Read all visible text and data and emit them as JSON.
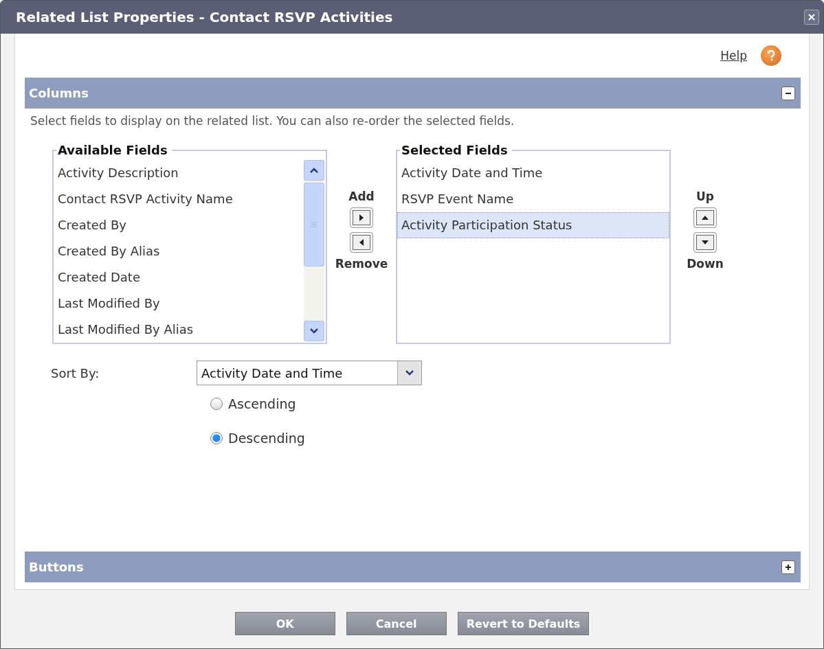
{
  "window": {
    "title": "Related List Properties - Contact RSVP Activities"
  },
  "help": {
    "label": "Help"
  },
  "sections": [
    {
      "title": "Columns",
      "expanded": true
    },
    {
      "title": "Buttons",
      "expanded": false
    }
  ],
  "description": "Select fields to display on the related list. You can also re-order the selected fields.",
  "available_fields": {
    "legend": "Available Fields",
    "items": [
      {
        "label": "Activity Description"
      },
      {
        "label": "Contact RSVP Activity Name"
      },
      {
        "label": "Created By"
      },
      {
        "label": "Created By Alias"
      },
      {
        "label": "Created Date"
      },
      {
        "label": "Last Modified By"
      },
      {
        "label": "Last Modified By Alias"
      }
    ]
  },
  "add_remove": {
    "add": "Add",
    "remove": "Remove"
  },
  "selected_fields": {
    "legend": "Selected Fields",
    "items": [
      {
        "label": "Activity Date and Time",
        "selected": false
      },
      {
        "label": "RSVP Event Name",
        "selected": false
      },
      {
        "label": "Activity Participation Status",
        "selected": true
      }
    ]
  },
  "up_down": {
    "up": "Up",
    "down": "Down"
  },
  "sort": {
    "label": "Sort By:",
    "value": "Activity Date and Time",
    "options": [
      {
        "label": "Ascending",
        "selected": false
      },
      {
        "label": "Descending",
        "selected": true
      }
    ]
  },
  "buttons": [
    {
      "label": "OK"
    },
    {
      "label": "Cancel"
    },
    {
      "label": "Revert to Defaults"
    }
  ]
}
